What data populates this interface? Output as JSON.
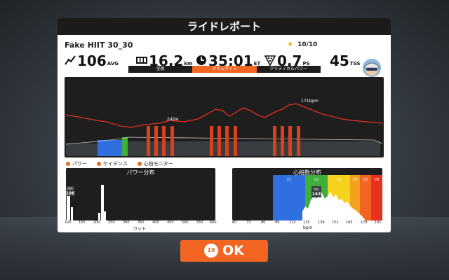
{
  "report": {
    "title": "ライドレポート",
    "ride_name": "Fake HIIT 30_30",
    "rating": "10/10"
  },
  "stats": {
    "power": {
      "value": "106",
      "unit": "AVG"
    },
    "distance": {
      "value": "16.2",
      "unit": "km"
    },
    "time": {
      "value": "35:01",
      "unit": "ET"
    },
    "ps": {
      "value": "0.7",
      "unit": "PS"
    },
    "tss": {
      "value": "45",
      "unit": "TSS"
    }
  },
  "tabs": [
    {
      "label": "全般"
    },
    {
      "label": "タイムライン",
      "active": true
    },
    {
      "label": "クリティカルパワー"
    }
  ],
  "timeline": {
    "hr_peak_label": "171bpm",
    "power_peak_label": "242w"
  },
  "legend": {
    "power": "パワー",
    "cadence": "ケイデンス",
    "hr": "心拍モニター"
  },
  "power_dist": {
    "title": "パワー分布",
    "avg_label": "AVE",
    "avg_value": "106",
    "xlabel": "ワット",
    "ticks": [
      "100",
      "150",
      "200",
      "250",
      "300",
      "350",
      "400",
      "450",
      "500",
      "550",
      "600"
    ]
  },
  "hr_dist": {
    "title": "心拍数分布",
    "avg_label": "AVE",
    "avg_value": "143",
    "xlabel": "bpm",
    "ticks": [
      "60",
      "73",
      "86",
      "99",
      "112",
      "125",
      "139",
      "152",
      "165",
      "178",
      "191"
    ],
    "zones": [
      "Z1",
      "Z2",
      "Z3",
      "Z4",
      "Z5",
      "Z6"
    ],
    "zone_colors": [
      "#2f6fe0",
      "#3fae3a",
      "#f6d21c",
      "#f2a21c",
      "#f26522",
      "#e8301c"
    ]
  },
  "ok": {
    "label": "OK",
    "countdown": "19"
  },
  "colors": {
    "accent": "#f26522",
    "hr_line": "#e8301c",
    "power_bar": "#d9401c",
    "zone1": "#2f6fe0",
    "zone2": "#3fae3a"
  }
}
